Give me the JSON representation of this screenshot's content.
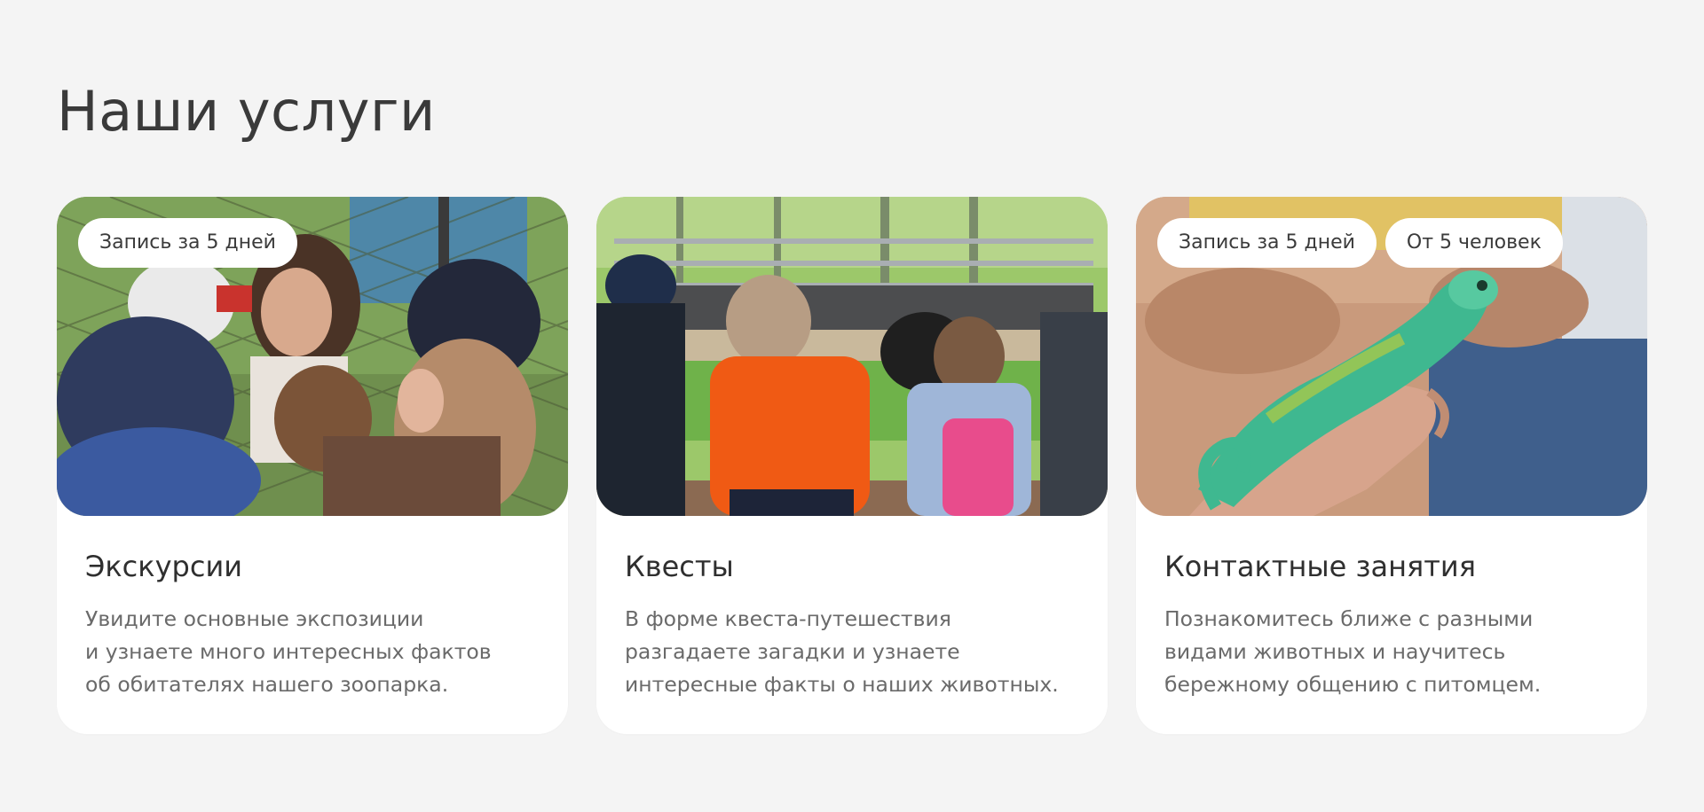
{
  "section": {
    "title": "Наши услуги"
  },
  "cards": [
    {
      "tags": [
        "Запись за 5 дней"
      ],
      "title": "Экскурсии",
      "text": "Увидите основные экспозиции\nи узнаете много интересных фактов\nоб обитателях нашего зоопарка."
    },
    {
      "tags": [],
      "title": "Квесты",
      "text": "В форме квеста-путешествия\nразгадаете загадки и узнаете\nинтересные факты о наших животных."
    },
    {
      "tags": [
        "Запись за 5 дней",
        "От 5 человек"
      ],
      "title": "Контактные занятия",
      "text": "Познакомитесь ближе с разными\nвидами животных и научитесь\nбережному общению с питомцем."
    }
  ]
}
